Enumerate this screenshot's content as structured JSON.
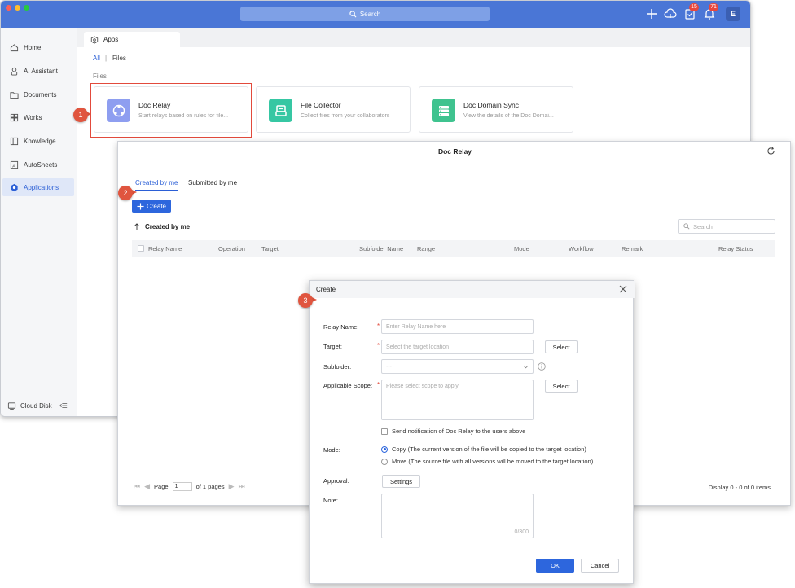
{
  "titlebar": {
    "search_placeholder": "Search",
    "tasks_badge": "15",
    "notifications_badge": "71",
    "avatar_initial": "E"
  },
  "sidebar": {
    "items": [
      {
        "label": "Home",
        "icon": "home-icon"
      },
      {
        "label": "AI Assistant",
        "icon": "ai-assistant-icon"
      },
      {
        "label": "Documents",
        "icon": "folder-icon"
      },
      {
        "label": "Works",
        "icon": "grid-icon"
      },
      {
        "label": "Knowledge",
        "icon": "book-icon"
      },
      {
        "label": "AutoSheets",
        "icon": "sheet-icon"
      },
      {
        "label": "Applications",
        "icon": "applications-icon",
        "active": true
      }
    ],
    "cloud_disk": "Cloud Disk"
  },
  "tab": {
    "apps_label": "Apps"
  },
  "filters": {
    "all": "All",
    "separator": "|",
    "files": "Files"
  },
  "section": {
    "files_heading": "Files"
  },
  "apps": [
    {
      "name": "Doc Relay",
      "desc": "Start relays based on rules for file...",
      "color": "#8e9ef0"
    },
    {
      "name": "File Collector",
      "desc": "Collect files from your collaborators",
      "color": "#36c7a3"
    },
    {
      "name": "Doc Domain Sync",
      "desc": "View the details of the Doc Domai...",
      "color": "#3fc38f"
    }
  ],
  "steps": {
    "one": "1",
    "two": "2",
    "three": "3"
  },
  "doc_relay": {
    "title": "Doc Relay",
    "tabs": {
      "created": "Created by me",
      "submitted": "Submitted by me"
    },
    "create_label": "Create",
    "sort_label": "Created by me",
    "search_placeholder": "Search",
    "columns": [
      "Relay Name",
      "Operation",
      "Target",
      "Subfolder Name",
      "Range",
      "Mode",
      "Workflow",
      "Remark",
      "Relay Status"
    ],
    "pager": {
      "page_word": "Page",
      "page_value": "1",
      "of_pages": "of 1 pages"
    },
    "display_count": "Display 0 - 0 of 0 items"
  },
  "create_dialog": {
    "title": "Create",
    "relay_name_label": "Relay Name:",
    "relay_name_placeholder": "Enter Relay Name here",
    "target_label": "Target:",
    "target_placeholder": "Select the target location",
    "select_label": "Select",
    "subfolder_label": "Subfolder:",
    "subfolder_value": "---",
    "scope_label": "Applicable Scope:",
    "scope_placeholder": "Please select scope to apply",
    "notify_label": "Send notification of Doc Relay to the users above",
    "mode_label": "Mode:",
    "mode_copy": "Copy (The current version of the file will be copied to the target location)",
    "mode_move": "Move (The source file with all versions will be moved to the target location)",
    "approval_label": "Approval:",
    "settings_label": "Settings",
    "note_label": "Note:",
    "note_counter": "0/300",
    "ok_label": "OK",
    "cancel_label": "Cancel"
  }
}
